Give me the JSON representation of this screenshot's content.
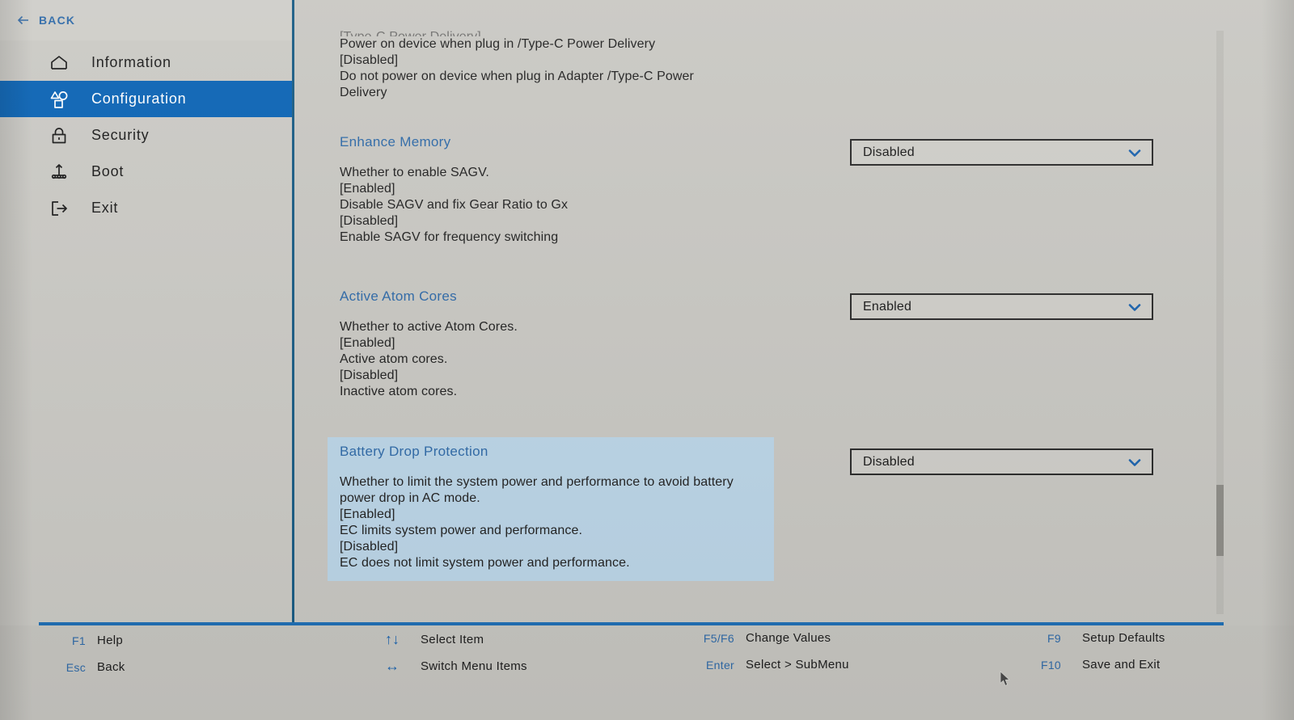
{
  "header": {
    "back_label": "BACK",
    "back_icon": "arrow-left-icon"
  },
  "sidebar": {
    "items": [
      {
        "label": "Information",
        "icon": "home-icon",
        "active": false
      },
      {
        "label": "Configuration",
        "icon": "shapes-icon",
        "active": true
      },
      {
        "label": "Security",
        "icon": "lock-icon",
        "active": false
      },
      {
        "label": "Boot",
        "icon": "boot-icon",
        "active": false
      },
      {
        "label": "Exit",
        "icon": "exit-icon",
        "active": false
      }
    ]
  },
  "main": {
    "clipped_top": {
      "cut_line": "[Type-C Power Delivery]",
      "lines": [
        "Power on device when plug in /Type-C Power Delivery",
        "[Disabled]",
        "Do not power on device when plug in Adapter /Type-C Power",
        "Delivery"
      ]
    },
    "settings": [
      {
        "title": "Enhance Memory",
        "summary": "Whether to enable SAGV.",
        "detail": [
          "[Enabled]",
          "Disable SAGV and fix Gear Ratio to Gx",
          "[Disabled]",
          "Enable SAGV for frequency switching"
        ],
        "value": "Disabled",
        "selected": false
      },
      {
        "title": "Active Atom Cores",
        "summary": "Whether to active Atom Cores.",
        "detail": [
          "[Enabled]",
          "Active atom cores.",
          "[Disabled]",
          "Inactive atom cores."
        ],
        "value": "Enabled",
        "selected": false
      },
      {
        "title": "Battery Drop Protection",
        "summary": "Whether to limit the system power and performance to avoid battery power drop in AC mode.",
        "detail": [
          "[Enabled]",
          "EC limits system power and performance.",
          "[Disabled]",
          "EC does not limit system power and performance."
        ],
        "value": "Disabled",
        "selected": true
      }
    ]
  },
  "footer": {
    "hints": [
      {
        "key": "F1",
        "action": "Help",
        "glyph": ""
      },
      {
        "key": "Esc",
        "action": "Back",
        "glyph": ""
      },
      {
        "key": "",
        "action": "Select Item",
        "glyph": "↑↓"
      },
      {
        "key": "",
        "action": "Switch Menu Items",
        "glyph": "↔"
      },
      {
        "key": "F5/F6",
        "action": "Change Values",
        "glyph": ""
      },
      {
        "key": "Enter",
        "action": "Select > SubMenu",
        "glyph": ""
      },
      {
        "key": "F9",
        "action": "Setup Defaults",
        "glyph": ""
      },
      {
        "key": "F10",
        "action": "Save and Exit",
        "glyph": ""
      }
    ]
  },
  "colors": {
    "accent_blue": "#0b64b5",
    "link_blue": "#2f6aa8",
    "selected_row": "#bcd6e8",
    "background": "#c9c8c3",
    "rule": "#1f6fb5"
  }
}
